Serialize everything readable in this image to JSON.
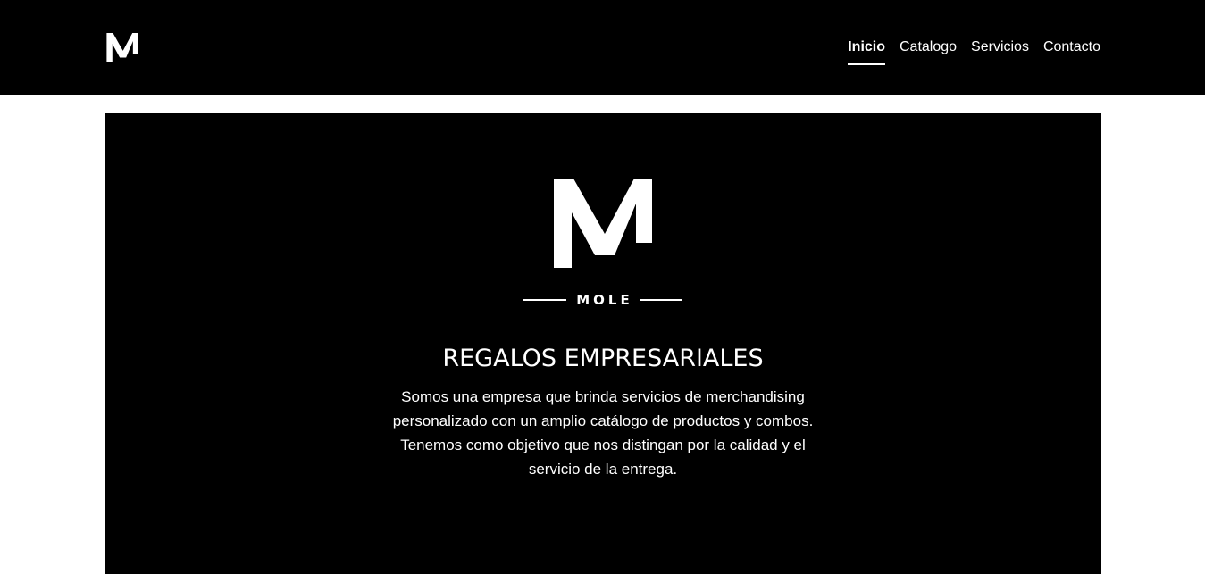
{
  "nav": {
    "logo_letter": "M",
    "links": [
      {
        "label": "Inicio",
        "active": true
      },
      {
        "label": "Catalogo",
        "active": false
      },
      {
        "label": "Servicios",
        "active": false
      },
      {
        "label": "Contacto",
        "active": false
      }
    ]
  },
  "hero": {
    "logo_letter": "M",
    "brand_name": "MOLE",
    "title": "REGALOS EMPRESARIALES",
    "description": "Somos una empresa que brinda servicios de merchandising personalizado con un amplio catálogo de productos y combos. Tenemos como objetivo que nos distingan por la calidad y el servicio de la entrega."
  },
  "colors": {
    "background": "#ffffff",
    "nav_background": "#000000",
    "hero_background": "#000000",
    "text": "#ffffff"
  }
}
